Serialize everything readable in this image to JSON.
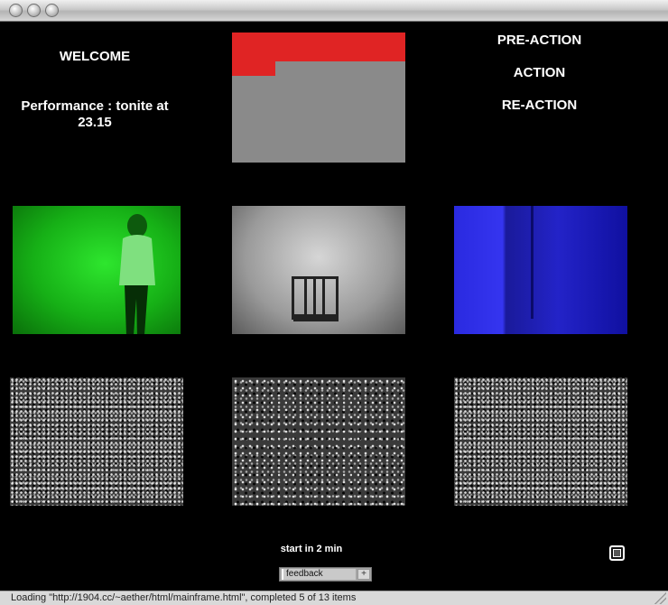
{
  "window": {
    "controls": [
      "close",
      "minimize",
      "zoom"
    ]
  },
  "left_column": {
    "welcome": "WELCOME",
    "performance": "Performance : tonite at 23.15"
  },
  "right_column": {
    "items": [
      "PRE-ACTION",
      "ACTION",
      "RE-ACTION"
    ]
  },
  "colors": {
    "red_block": "#e02424",
    "green_panel": "#16b016",
    "blue_panel": "#2323c8",
    "background": "#000000"
  },
  "footer": {
    "start_text": "start in 2 min",
    "feedback_value": "feedback",
    "feedback_add": "+",
    "fullscreen_icon": "fullscreen-icon"
  },
  "status": {
    "text": "Loading \"http://1904.cc/~aether/html/mainframe.html\", completed 5 of 13 items"
  }
}
